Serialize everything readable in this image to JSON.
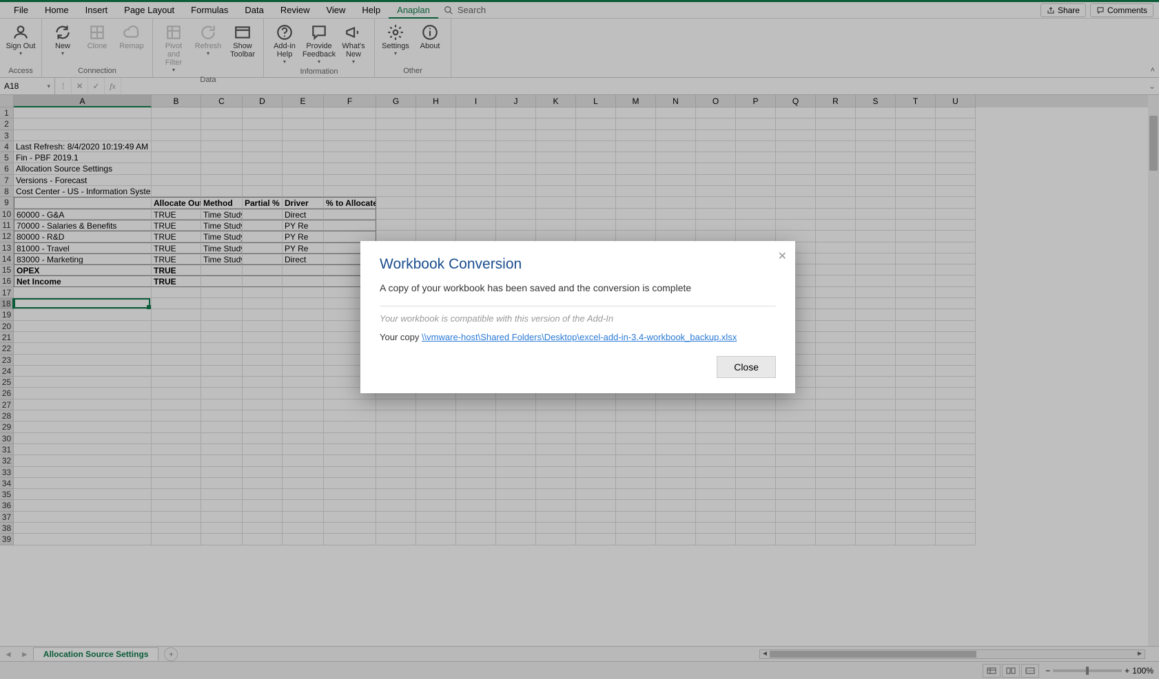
{
  "menus": [
    "File",
    "Home",
    "Insert",
    "Page Layout",
    "Formulas",
    "Data",
    "Review",
    "View",
    "Help",
    "Anaplan"
  ],
  "active_menu": "Anaplan",
  "search_placeholder": "Search",
  "share_label": "Share",
  "comments_label": "Comments",
  "ribbon": {
    "groups": [
      {
        "name": "Access",
        "buttons": [
          {
            "label": "Sign Out",
            "sub": "",
            "icon": "user",
            "drop": true
          }
        ]
      },
      {
        "name": "Connection",
        "buttons": [
          {
            "label": "New",
            "icon": "refresh",
            "drop": true
          },
          {
            "label": "Clone",
            "icon": "grid",
            "disabled": true
          },
          {
            "label": "Remap",
            "icon": "cloud",
            "disabled": true
          }
        ]
      },
      {
        "name": "Data",
        "buttons": [
          {
            "label": "Pivot and Filter",
            "icon": "pivot",
            "disabled": true,
            "drop": true
          },
          {
            "label": "Refresh",
            "icon": "refresh2",
            "disabled": true,
            "drop": true
          },
          {
            "label": "Show Toolbar",
            "icon": "toolbar"
          }
        ]
      },
      {
        "name": "Information",
        "buttons": [
          {
            "label": "Add-in Help",
            "icon": "help",
            "drop": true
          },
          {
            "label": "Provide Feedback",
            "icon": "feedback",
            "drop": true
          },
          {
            "label": "What's New",
            "icon": "megaphone",
            "drop": true
          }
        ]
      },
      {
        "name": "Other",
        "buttons": [
          {
            "label": "Settings",
            "icon": "gear",
            "drop": true
          },
          {
            "label": "About",
            "icon": "info"
          }
        ]
      }
    ]
  },
  "namebox": "A18",
  "formula": "",
  "columns": [
    "A",
    "B",
    "C",
    "D",
    "E",
    "F",
    "G",
    "H",
    "I",
    "J",
    "K",
    "L",
    "M",
    "N",
    "O",
    "P",
    "Q",
    "R",
    "S",
    "T",
    "U"
  ],
  "col_widths": {
    "A": 200,
    "B": 72,
    "C": 60,
    "D": 58,
    "E": 60,
    "F": 76,
    "default": 58
  },
  "selected_col": "A",
  "selected_row": 18,
  "row_count": 39,
  "cells": {
    "4": {
      "A": "Last Refresh: 8/4/2020 10:19:49 AM"
    },
    "5": {
      "A": "Fin - PBF 2019.1"
    },
    "6": {
      "A": "Allocation Source Settings"
    },
    "7": {
      "A": "Versions - Forecast"
    },
    "8": {
      "A": "Cost Center - US - Information Systems"
    },
    "9": {
      "B": "Allocate Out?",
      "C": "Method",
      "D": "Partial %",
      "E": "Driver",
      "F": "% to Allocate",
      "bold": true,
      "border": true
    },
    "10": {
      "A": "    60000 - G&A",
      "B": "TRUE",
      "C": "Time Study",
      "E": "Direct",
      "border": true
    },
    "11": {
      "A": "    70000 - Salaries & Benefits",
      "B": "TRUE",
      "C": "Time Study",
      "E": "PY Re",
      "border": true
    },
    "12": {
      "A": "    80000 - R&D",
      "B": "TRUE",
      "C": "Time Study",
      "E": "PY Re",
      "border": true
    },
    "13": {
      "A": "    81000 - Travel",
      "B": "TRUE",
      "C": "Time Study",
      "E": "PY Re",
      "border": true
    },
    "14": {
      "A": "    83000 - Marketing",
      "B": "TRUE",
      "C": "Time Study",
      "E": "Direct",
      "border": true
    },
    "15": {
      "A": "  OPEX",
      "B": "TRUE",
      "bold": true,
      "border": true
    },
    "16": {
      "A": "Net Income",
      "B": "TRUE",
      "bold": true,
      "border": true,
      "last": true
    }
  },
  "sheet_tab": "Allocation Source Settings",
  "zoom": "100%",
  "modal": {
    "title": "Workbook Conversion",
    "message": "A copy of your workbook has been saved and the conversion is complete",
    "compat": "Your workbook is compatible with this version of the Add-In",
    "copy_prefix": "Your copy ",
    "copy_link": "\\\\vmware-host\\Shared Folders\\Desktop\\excel-add-in-3.4-workbook_backup.xlsx",
    "close": "Close"
  }
}
